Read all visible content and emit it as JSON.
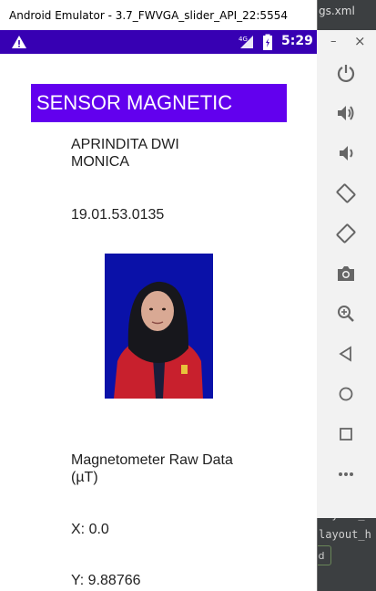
{
  "window": {
    "title": "Android Emulator - 3.7_FWVGA_slider_API_22:5554",
    "background_tab": "gs.xml"
  },
  "status_bar": {
    "network": "4G",
    "time": "5:29",
    "warning_icon": "warning-icon",
    "battery_icon": "battery-icon"
  },
  "app": {
    "title": "SENSOR MAGNETIC",
    "name": "APRINDITA DWI MONICA",
    "nim": "19.01.53.0135",
    "section_label": "Magnetometer Raw Data (µT)",
    "x_value": "X: 0.0",
    "y_value": "Y: 9.88766"
  },
  "toolbar": {
    "minimize": "–",
    "close": "×",
    "buttons": [
      "power-icon",
      "volume-up-icon",
      "volume-down-icon",
      "rotate-left-icon",
      "rotate-right-icon",
      "camera-icon",
      "zoom-icon",
      "back-icon",
      "home-icon",
      "overview-icon",
      "more-icon"
    ]
  },
  "editor": {
    "line1": "layout_w",
    "line2": "layout_h",
    "badge": "d"
  },
  "colors": {
    "status_bar": "#3700b3",
    "app_title_bg": "#6200ee",
    "photo_bg": "#0a11a8"
  }
}
